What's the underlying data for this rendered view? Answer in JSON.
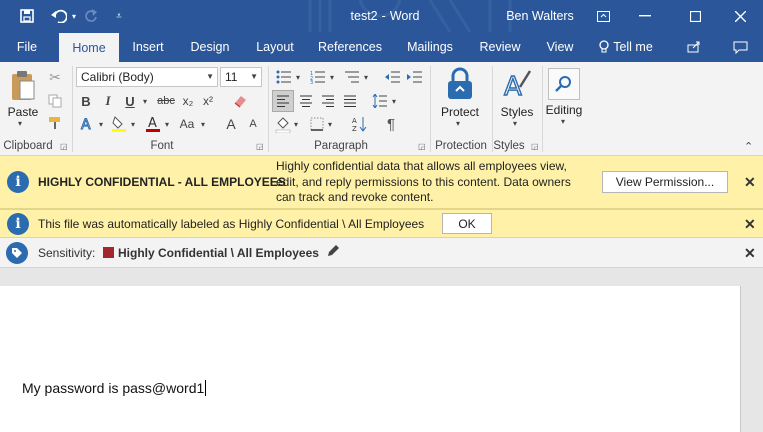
{
  "title_bar": {
    "doc_title": "test2",
    "sep": "-",
    "app_name": "Word",
    "user_name": "Ben Walters"
  },
  "tabs": [
    {
      "label": "File"
    },
    {
      "label": "Home"
    },
    {
      "label": "Insert"
    },
    {
      "label": "Design"
    },
    {
      "label": "Layout"
    },
    {
      "label": "References"
    },
    {
      "label": "Mailings"
    },
    {
      "label": "Review"
    },
    {
      "label": "View"
    },
    {
      "label": "Tell me"
    }
  ],
  "ribbon": {
    "paste_label": "Paste",
    "font_name": "Calibri (Body)",
    "font_size": "11",
    "bold": "B",
    "italic": "I",
    "underline": "U",
    "strike": "abc",
    "subscript": "x₂",
    "superscript": "x²",
    "change_case": "Aa",
    "grow_font": "A",
    "shrink_font": "A",
    "protect_label": "Protect",
    "styles_label": "Styles",
    "editing_label": "Editing",
    "groups": [
      "Clipboard",
      "Font",
      "Paragraph",
      "Protection",
      "Styles"
    ]
  },
  "banner_confidential": {
    "title": "HIGHLY CONFIDENTIAL - ALL EMPLOYEES",
    "desc_line1": "Highly confidential data that allows all employees view,",
    "desc_line2": "edit, and reply permissions to this content. Data owners",
    "desc_line3": "can track and revoke content.",
    "button_label": "View Permission..."
  },
  "banner_label": {
    "text": "This file was automatically labeled as Highly Confidential \\ All Employees",
    "button_label": "OK"
  },
  "sensitivity_bar": {
    "label": "Sensitivity:",
    "value": "Highly Confidential \\ All Employees",
    "swatch_color": "#a4262c"
  },
  "document": {
    "body_text": "My password is pass@word1"
  },
  "colors": {
    "brand": "#2b579a",
    "banner": "#fff2a8",
    "highlight": "#ffff00",
    "font_color": "#c00000"
  }
}
